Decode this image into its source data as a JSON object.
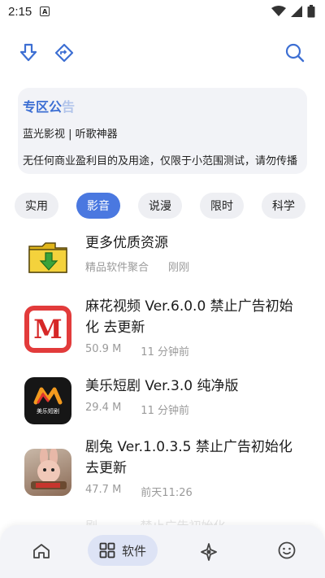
{
  "status": {
    "time": "2:15",
    "notification_badge": "A"
  },
  "notice": {
    "title_visible": "专区公",
    "title_faded": "告",
    "line1": "蓝光影视 | 听歌神器",
    "line2": "无任何商业盈利目的及用途，仅限于小范围测试，请勿传播"
  },
  "tabs": [
    {
      "label": "实用",
      "active": false
    },
    {
      "label": "影音",
      "active": true
    },
    {
      "label": "说漫",
      "active": false
    },
    {
      "label": "限时",
      "active": false
    },
    {
      "label": "科学",
      "active": false
    }
  ],
  "items": [
    {
      "title_line1": "更多优质资源",
      "title_line2": "",
      "meta1": "精品软件聚合",
      "meta2": "刚刚",
      "icon": "folder-download-icon"
    },
    {
      "title_line1": "麻花视频 Ver.6.0.0 禁止广告初始",
      "title_line2": "化 去更新",
      "meta1": "50.9 M",
      "meta2": "11 分钟前",
      "icon": "mahua-app-icon"
    },
    {
      "title_line1": "美乐短剧 Ver.3.0 纯净版",
      "title_line2": "",
      "meta1": "29.4 M",
      "meta2": "11 分钟前",
      "icon": "meile-app-icon",
      "icon_caption": "美乐短剧"
    },
    {
      "title_line1": "剧兔 Ver.1.0.3.5 禁止广告初始化",
      "title_line2": "去更新",
      "meta1": "47.7 M",
      "meta2": "前天11:26",
      "icon": "jutu-app-icon"
    }
  ],
  "partial_row": "剧... ...  ...禁止广告初始化",
  "bottom_nav": {
    "software_label": "软件"
  },
  "colors": {
    "accent": "#4a78e0",
    "notice_title": "#3d6fd3",
    "nav_active_bg": "#dde3f5"
  }
}
